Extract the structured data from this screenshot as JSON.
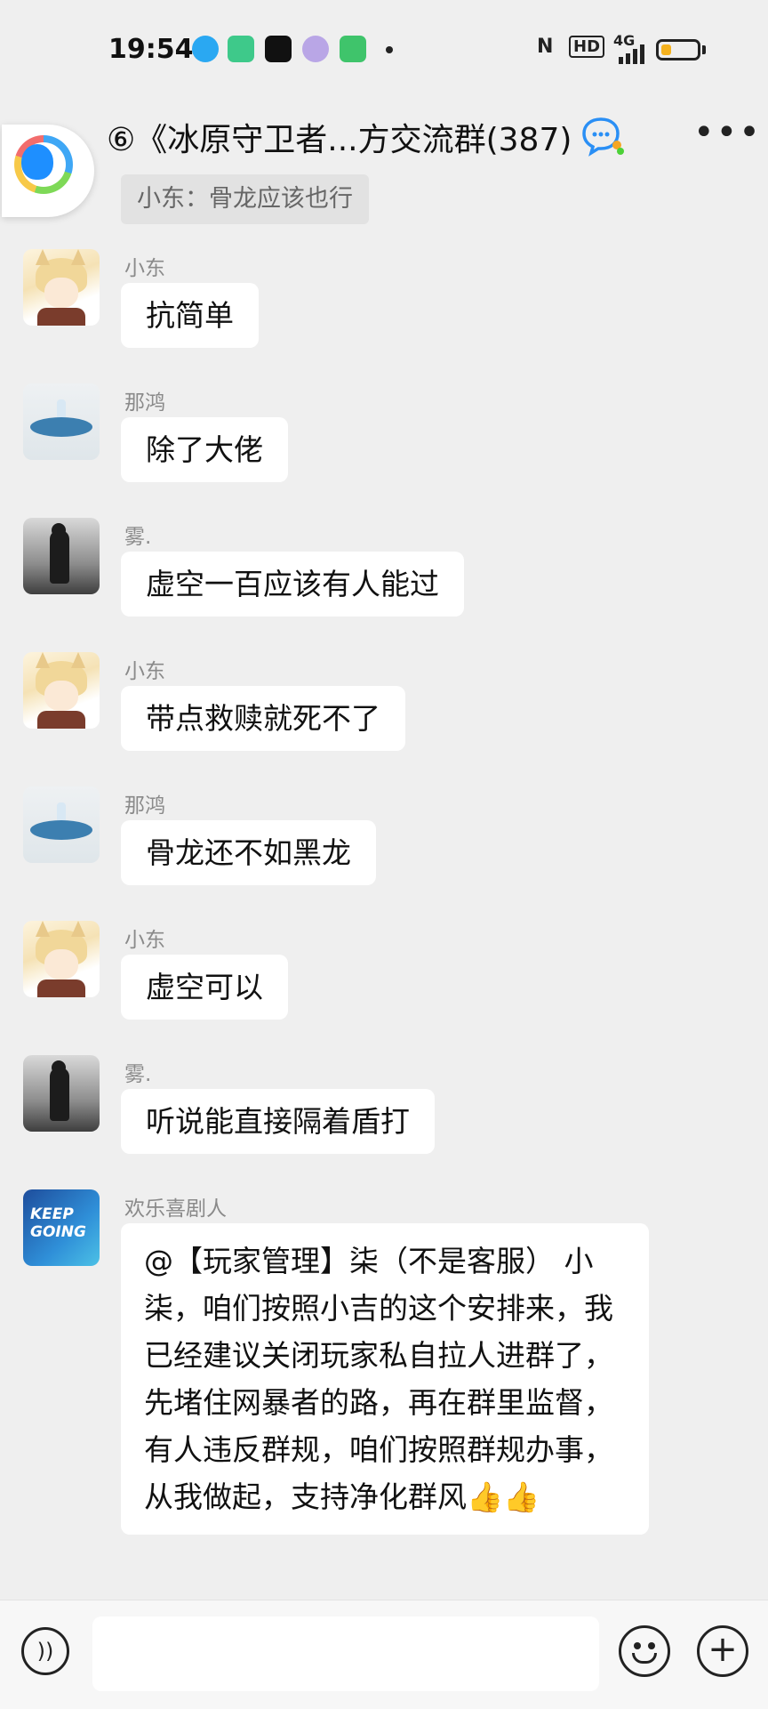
{
  "status_bar": {
    "time": "19:54",
    "network": "4G",
    "hd": "HD",
    "nfc": "N",
    "battery_level": 0.3,
    "battery_color": "#f5b21f"
  },
  "header": {
    "back_icon": "chevron-left-icon",
    "title": "⑥《冰原守卫者...方交流群(387)",
    "group_icon": "group-chat-icon",
    "more_icon": "more-icon"
  },
  "top_quote": "小东：骨龙应该也行",
  "messages": [
    {
      "sender": "小东",
      "text": "抗简单"
    },
    {
      "sender": "那鸿",
      "text": "除了大佬"
    },
    {
      "sender": "雾.",
      "text": "虚空一百应该有人能过"
    },
    {
      "sender": "小东",
      "text": "带点救赎就死不了"
    },
    {
      "sender": "那鸿",
      "text": "骨龙还不如黑龙"
    },
    {
      "sender": "小东",
      "text": "虚空可以"
    },
    {
      "sender": "雾.",
      "text": "听说能直接隔着盾打"
    },
    {
      "sender": "欢乐喜剧人",
      "text": "@【玩家管理】柒（不是客服） 小柒，咱们按照小吉的这个安排来，我已经建议关闭玩家私自拉人进群了，先堵住网暴者的路，再在群里监督，有人违反群规，咱们按照群规办事，从我做起，支持净化群风👍👍"
    }
  ],
  "avatars": {
    "keep_text": "KEEP GOING"
  },
  "input_bar": {
    "placeholder": "",
    "voice_icon": "voice-icon",
    "emoji_icon": "emoji-icon",
    "plus_icon": "plus-icon"
  }
}
